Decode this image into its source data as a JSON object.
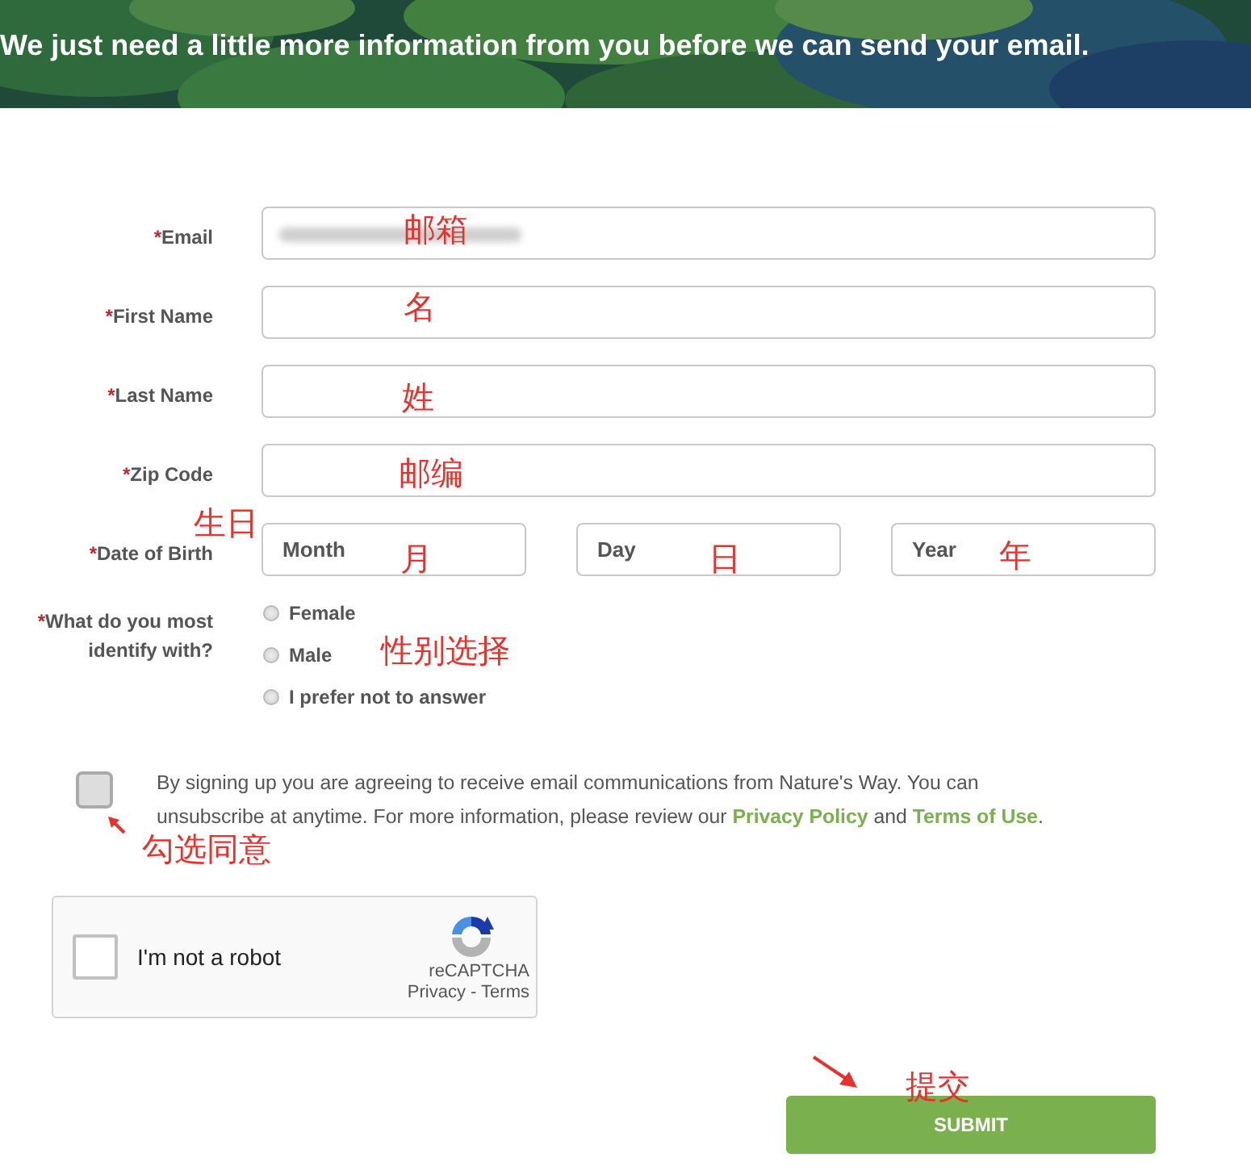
{
  "header": {
    "kind": "picture",
    "message": "We just need a little more information from you before we can send your email."
  },
  "fields": [
    {
      "kind": "text",
      "required_mark": "*",
      "label": "Email",
      "value_blurred": true,
      "note": "邮箱"
    },
    {
      "kind": "text",
      "required_mark": "*",
      "label": "First Name",
      "note": "名"
    },
    {
      "kind": "text",
      "required_mark": "*",
      "label": "Last Name",
      "note": "姓"
    },
    {
      "kind": "text",
      "required_mark": "*",
      "label": "Zip Code",
      "note": "邮编"
    },
    {
      "kind": "date",
      "required_mark": "*",
      "label": "Date of Birth",
      "note": "生日",
      "parts": [
        {
          "placeholder": "Month",
          "note": "月"
        },
        {
          "placeholder": "Day",
          "note": "日"
        },
        {
          "placeholder": "Year",
          "note": "年"
        }
      ]
    },
    {
      "kind": "radio",
      "required_mark": "*",
      "label": "What do you most identify with?",
      "note": "性别选择",
      "options": [
        {
          "label": "Female",
          "selected": false
        },
        {
          "label": "Male",
          "selected": false
        },
        {
          "label": "I prefer not to answer",
          "selected": false
        }
      ]
    }
  ],
  "consent": {
    "checked": false,
    "note": "勾选同意",
    "text_before": "By signing up you are agreeing to receive email communications from Nature's Way. You can unsubscribe at anytime. For more information, please review our",
    "links": [
      "Privacy Policy",
      "Terms of Use"
    ],
    "joiner": "and",
    "text_after": "."
  },
  "recaptcha": {
    "checked": false,
    "label": "I'm not a robot",
    "brand": "reCAPTCHA",
    "links": "Privacy - Terms"
  },
  "submit": {
    "label": "SUBMIT",
    "note": "提交"
  }
}
